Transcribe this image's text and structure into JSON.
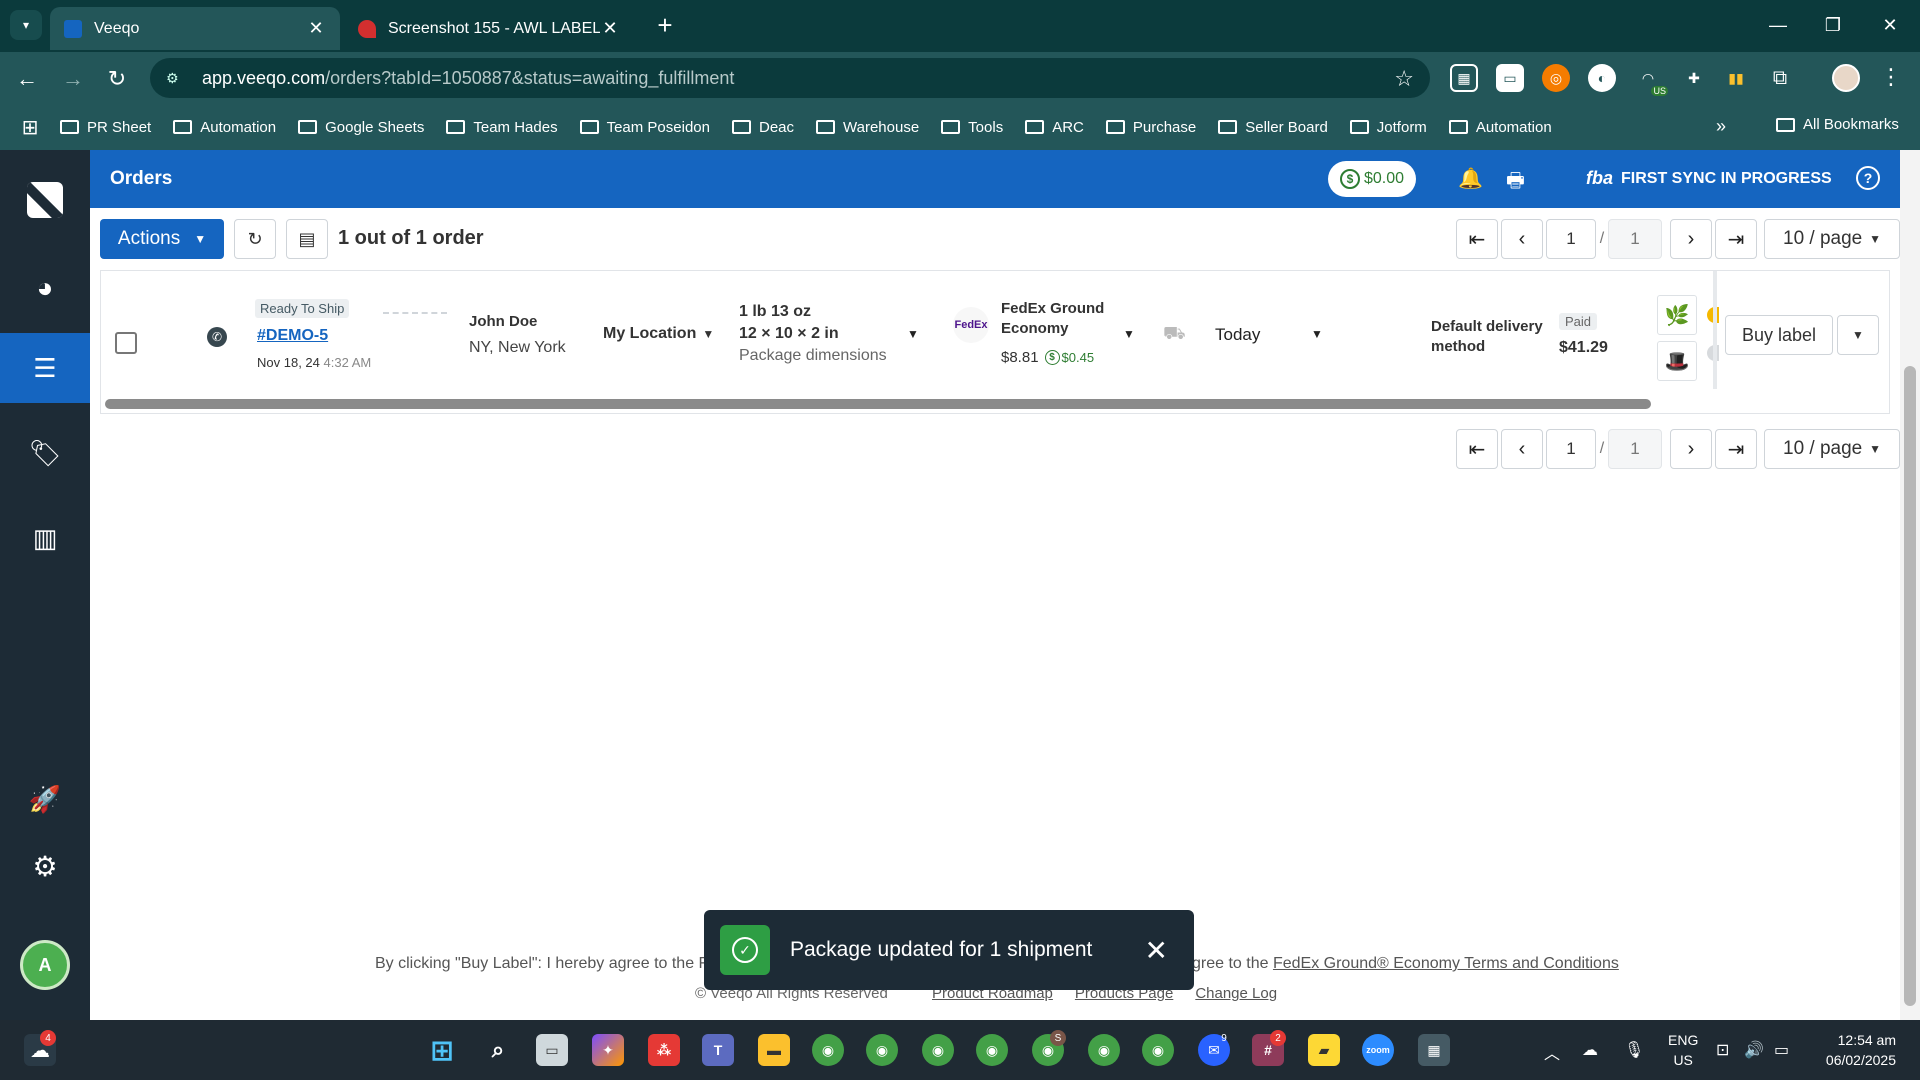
{
  "browser": {
    "tabs": [
      {
        "title": "Veeqo",
        "active": true
      },
      {
        "title": "Screenshot 155 - AWL LABEL",
        "active": false
      }
    ],
    "url_host": "app.veeqo.com",
    "url_path": "/orders?tabId=1050887&status=awaiting_fulfillment",
    "bookmarks": [
      "PR Sheet",
      "Automation",
      "Google Sheets",
      "Team Hades",
      "Team Poseidon",
      "Deac",
      "Warehouse",
      "Tools",
      "ARC",
      "Purchase",
      "Seller Board",
      "Jotform",
      "Automation"
    ],
    "all_bookmarks": "All Bookmarks",
    "extension_badge": "US"
  },
  "app": {
    "page_title": "Orders",
    "balance": "$0.00",
    "fba_logo": "fba",
    "sync_status": "FIRST SYNC IN PROGRESS",
    "avatar_initial": "A",
    "colors": {
      "primary": "#1565c0",
      "sidebar": "#1d2b36",
      "success": "#2e9e44"
    }
  },
  "toolbar": {
    "actions_label": "Actions",
    "order_count": "1 out of 1 order"
  },
  "pagination": {
    "current_page": "1",
    "separator": "/",
    "total_pages": "1",
    "page_size": "10 / page"
  },
  "order": {
    "status": "Ready To Ship",
    "number": "#DEMO-5",
    "date": "Nov 18, 24",
    "time": "4:32 AM",
    "customer_name": "John Doe",
    "customer_location": "NY, New York",
    "warehouse": "My Location",
    "weight": "1 lb 13 oz",
    "dimensions": "12 × 10 × 2 in",
    "dimensions_label": "Package dimensions",
    "carrier_logo": "FedEx",
    "carrier_service": "FedEx Ground Economy",
    "shipping_cost": "$8.81",
    "savings": "$0.45",
    "ship_date": "Today",
    "delivery_method": "Default delivery method",
    "payment_status": "Paid",
    "total": "$41.29",
    "buy_label": "Buy label"
  },
  "footer": {
    "terms_left": "By clicking \"Buy Label\": I hereby agree to the F",
    "terms_right_prefix": "gree to the ",
    "terms_right_link": "FedEx Ground® Economy Terms and Conditions",
    "copyright": "© Veeqo All Rights Reserved",
    "links": [
      "Product Roadmap",
      "Products Page",
      "Change Log"
    ]
  },
  "toast": {
    "message": "Package updated for 1 shipment"
  },
  "taskbar": {
    "badges": {
      "weather": "4",
      "chrome_s": "S",
      "messenger": "9",
      "slack": "2"
    },
    "language": "ENG",
    "region": "US",
    "time": "12:54 am",
    "date": "06/02/2025"
  }
}
